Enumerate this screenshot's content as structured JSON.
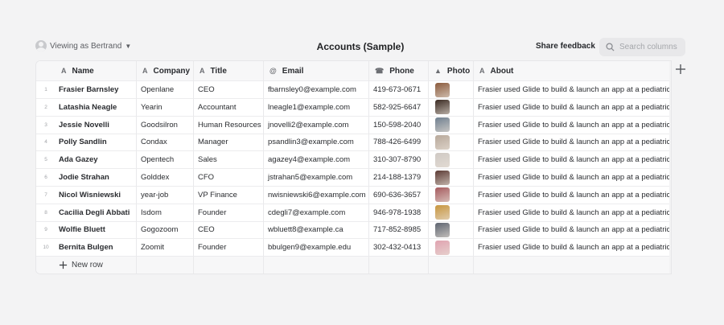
{
  "header": {
    "viewing_as": "Viewing as Bertrand",
    "title": "Accounts (Sample)",
    "share_feedback": "Share feedback",
    "search_placeholder": "Search columns"
  },
  "columns": [
    {
      "label": "Name",
      "icon": "text-icon",
      "glyph": "A"
    },
    {
      "label": "Company",
      "icon": "text-icon",
      "glyph": "A"
    },
    {
      "label": "Title",
      "icon": "text-icon",
      "glyph": "A"
    },
    {
      "label": "Email",
      "icon": "email-icon",
      "glyph": "@"
    },
    {
      "label": "Phone",
      "icon": "phone-icon",
      "glyph": "☎"
    },
    {
      "label": "Photo",
      "icon": "image-icon",
      "glyph": "▲"
    },
    {
      "label": "About",
      "icon": "text-icon",
      "glyph": "A"
    }
  ],
  "rows": [
    {
      "n": "1",
      "name": "Frasier Barnsley",
      "company": "Openlane",
      "title": "CEO",
      "email": "fbarnsley0@example.com",
      "phone": "419-673-0671",
      "photo_color": "#8a5a3c",
      "about": "Frasier used Glide to build & launch an app at a pediatric r"
    },
    {
      "n": "2",
      "name": "Latashia Neagle",
      "company": "Yearin",
      "title": "Accountant",
      "email": "lneagle1@example.com",
      "phone": "582-925-6647",
      "photo_color": "#3a2a22",
      "about": "Frasier used Glide to build & launch an app at a pediatric r"
    },
    {
      "n": "3",
      "name": "Jessie Novelli",
      "company": "Goodsilron",
      "title": "Human Resources",
      "email": "jnovelli2@example.com",
      "phone": "150-598-2040",
      "photo_color": "#6f7f8f",
      "about": "Frasier used Glide to build & launch an app at a pediatric r"
    },
    {
      "n": "4",
      "name": "Polly Sandlin",
      "company": "Condax",
      "title": "Manager",
      "email": "psandlin3@example.com",
      "phone": "788-426-6499",
      "photo_color": "#b7a89a",
      "about": "Frasier used Glide to build & launch an app at a pediatric r"
    },
    {
      "n": "5",
      "name": "Ada Gazey",
      "company": "Opentech",
      "title": "Sales",
      "email": "agazey4@example.com",
      "phone": "310-307-8790",
      "photo_color": "#cfc9c4",
      "about": "Frasier used Glide to build & launch an app at a pediatric r"
    },
    {
      "n": "6",
      "name": "Jodie Strahan",
      "company": "Golddex",
      "title": "CFO",
      "email": "jstrahan5@example.com",
      "phone": "214-188-1379",
      "photo_color": "#5b3a34",
      "about": "Frasier used Glide to build & launch an app at a pediatric r"
    },
    {
      "n": "7",
      "name": "Nicol Wisniewski",
      "company": "year-job",
      "title": "VP Finance",
      "email": "nwisniewski6@example.com",
      "phone": "690-636-3657",
      "photo_color": "#a55a5e",
      "about": "Frasier used Glide to build & launch an app at a pediatric r"
    },
    {
      "n": "8",
      "name": "Cacilia Degli Abbati",
      "company": "Isdom",
      "title": "Founder",
      "email": "cdegli7@example.com",
      "phone": "946-978-1938",
      "photo_color": "#c7953d",
      "about": "Frasier used Glide to build & launch an app at a pediatric r"
    },
    {
      "n": "9",
      "name": "Wolfie Bluett",
      "company": "Gogozoom",
      "title": "CEO",
      "email": "wbluett8@example.ca",
      "phone": "717-852-8985",
      "photo_color": "#5d6470",
      "about": "Frasier used Glide to build & launch an app at a pediatric r"
    },
    {
      "n": "10",
      "name": "Bernita Bulgen",
      "company": "Zoomit",
      "title": "Founder",
      "email": "bbulgen9@example.edu",
      "phone": "302-432-0413",
      "photo_color": "#e0a3b0",
      "about": "Frasier used Glide to build & launch an app at a pediatric r"
    }
  ],
  "new_row_label": "New row"
}
